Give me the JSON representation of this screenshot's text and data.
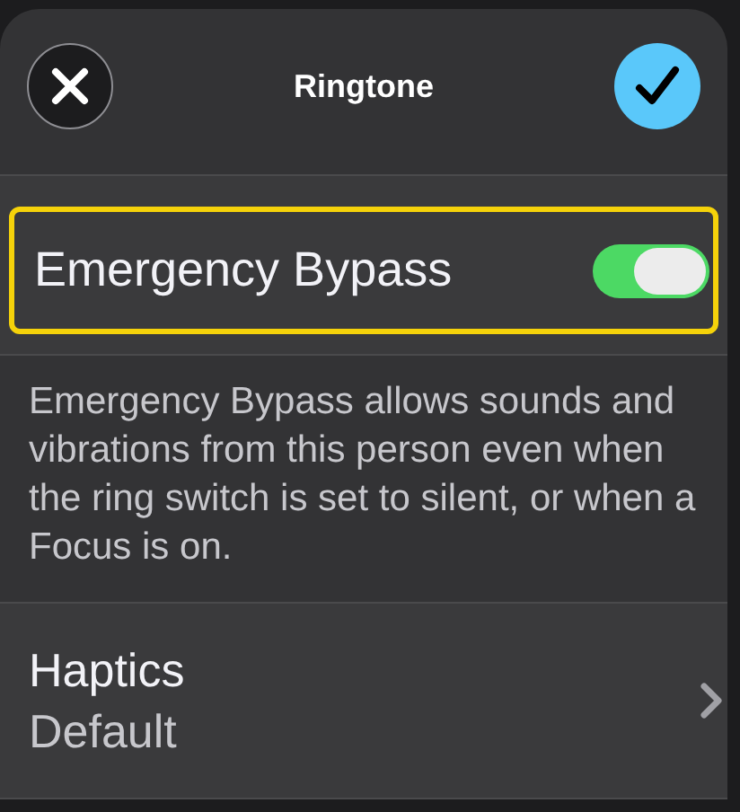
{
  "header": {
    "title": "Ringtone"
  },
  "emergency_bypass": {
    "label": "Emergency Bypass",
    "on": true,
    "highlighted": true
  },
  "description": "Emergency Bypass allows sounds and vibrations from this person even when the ring switch is set to silent, or when a Focus is on.",
  "haptics": {
    "label": "Haptics",
    "value": "Default"
  }
}
